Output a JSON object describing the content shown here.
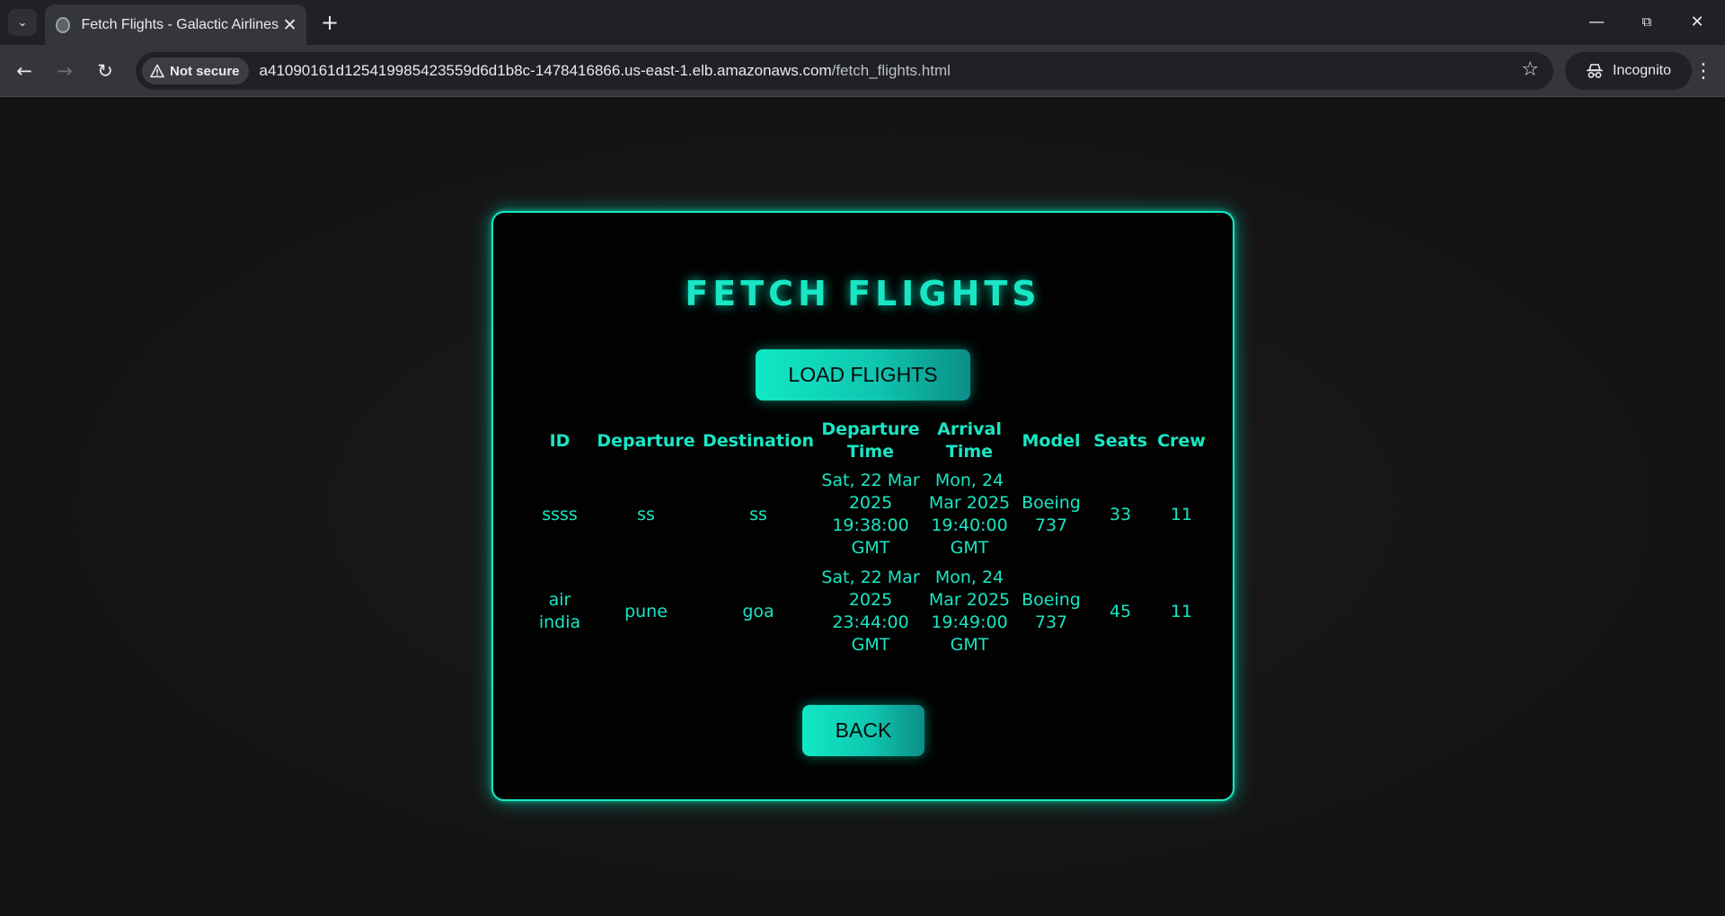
{
  "browser": {
    "tab_title": "Fetch Flights - Galactic Airlines",
    "new_tab_symbol": "+",
    "security_label": "Not secure",
    "url_host": "a41090161d125419985423559d6d1b8c-1478416866.us-east-1.elb.amazonaws.com",
    "url_path": "/fetch_flights.html",
    "profile_label": "Incognito"
  },
  "page": {
    "heading": "FETCH FLIGHTS",
    "load_button": "LOAD FLIGHTS",
    "back_button": "BACK"
  },
  "table": {
    "columns": [
      "ID",
      "Departure",
      "Destination",
      "Departure Time",
      "Arrival Time",
      "Model",
      "Seats",
      "Crew"
    ],
    "rows": [
      [
        "ssss",
        "ss",
        "ss",
        "Sat, 22 Mar 2025 19:38:00 GMT",
        "Mon, 24 Mar 2025 19:40:00 GMT",
        "Boeing 737",
        "33",
        "11"
      ],
      [
        "air india",
        "pune",
        "goa",
        "Sat, 22 Mar 2025 23:44:00 GMT",
        "Mon, 24 Mar 2025 19:49:00 GMT",
        "Boeing 737",
        "45",
        "11"
      ]
    ]
  },
  "theme": {
    "accent": "#19e6c4",
    "background": "#141414",
    "card": "#020202"
  }
}
